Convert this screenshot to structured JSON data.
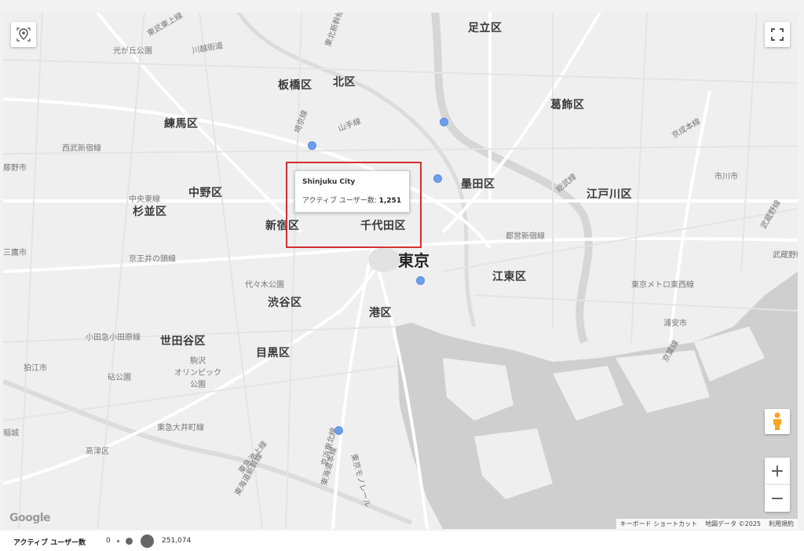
{
  "map": {
    "place_labels": [
      {
        "text": "足立区",
        "cls": "ward"
      },
      {
        "text": "板橋区",
        "cls": "ward"
      },
      {
        "text": "北区",
        "cls": "ward"
      },
      {
        "text": "葛飾区",
        "cls": "ward"
      },
      {
        "text": "練馬区",
        "cls": "ward"
      },
      {
        "text": "中野区",
        "cls": "ward"
      },
      {
        "text": "杉並区",
        "cls": "ward"
      },
      {
        "text": "新宿区",
        "cls": "ward"
      },
      {
        "text": "千代田区",
        "cls": "ward"
      },
      {
        "text": "墨田区",
        "cls": "ward"
      },
      {
        "text": "江戸川区",
        "cls": "ward"
      },
      {
        "text": "江東区",
        "cls": "ward"
      },
      {
        "text": "渋谷区",
        "cls": "ward"
      },
      {
        "text": "港区",
        "cls": "ward"
      },
      {
        "text": "世田谷区",
        "cls": "ward"
      },
      {
        "text": "目黒区",
        "cls": "ward"
      },
      {
        "text": "東京",
        "cls": "tokyo"
      },
      {
        "text": "光が丘公園",
        "cls": "small"
      },
      {
        "text": "西武新宿線",
        "cls": "small"
      },
      {
        "text": "中央東線",
        "cls": "small"
      },
      {
        "text": "京王井の頭線",
        "cls": "small"
      },
      {
        "text": "代々木公園",
        "cls": "small"
      },
      {
        "text": "小田急小田原線",
        "cls": "small"
      },
      {
        "text": "砧公園",
        "cls": "small"
      },
      {
        "text": "駒沢\nオリンピック\n公園",
        "cls": "small"
      },
      {
        "text": "東急大井町線",
        "cls": "small"
      },
      {
        "text": "高津区",
        "cls": "small"
      },
      {
        "text": "都営新宿線",
        "cls": "small"
      },
      {
        "text": "東京メトロ東西線",
        "cls": "small"
      },
      {
        "text": "浦安市",
        "cls": "small"
      },
      {
        "text": "市川市",
        "cls": "small"
      },
      {
        "text": "狛江市",
        "cls": "small"
      },
      {
        "text": "武蔵野線",
        "cls": "small"
      },
      {
        "text": "京葉線",
        "cls": "small"
      },
      {
        "text": "京成本線",
        "cls": "small"
      },
      {
        "text": "総武線",
        "cls": "small"
      },
      {
        "text": "山手線",
        "cls": "small"
      },
      {
        "text": "東武東上線",
        "cls": "small"
      },
      {
        "text": "川越街道",
        "cls": "small"
      },
      {
        "text": "埼京線",
        "cls": "small"
      },
      {
        "text": "東北新幹線",
        "cls": "small"
      },
      {
        "text": "東京モノレール",
        "cls": "small"
      },
      {
        "text": "京浜東北線",
        "cls": "small"
      },
      {
        "text": "東海道本線",
        "cls": "small"
      },
      {
        "text": "東急池上線",
        "cls": "small"
      },
      {
        "text": "東海道新幹線",
        "cls": "small"
      },
      {
        "text": "藤野市",
        "cls": "small"
      },
      {
        "text": "武蔵野線",
        "cls": "small"
      },
      {
        "text": "三鷹市",
        "cls": "small"
      },
      {
        "text": "稲城",
        "cls": "small"
      }
    ],
    "icons": {
      "locate": "locate-icon",
      "fullscreen": "fullscreen-icon",
      "pegman": "pegman-icon"
    },
    "zoom_in_label": "+",
    "zoom_out_label": "−",
    "google_logo": "Google",
    "attribution": {
      "shortcuts": "キーボード ショートカット",
      "map_data": "地図データ ©2025",
      "terms": "利用規約"
    },
    "marker_color": "#6d9eeb",
    "highlight_color": "#d32f2f"
  },
  "tooltip": {
    "title": "Shinjuku City",
    "metric_label": "アクティブ ユーザー数:",
    "metric_value": "1,251"
  },
  "legend": {
    "label": "アクティブ ユーザー数",
    "min": "0",
    "max": "251,074"
  }
}
